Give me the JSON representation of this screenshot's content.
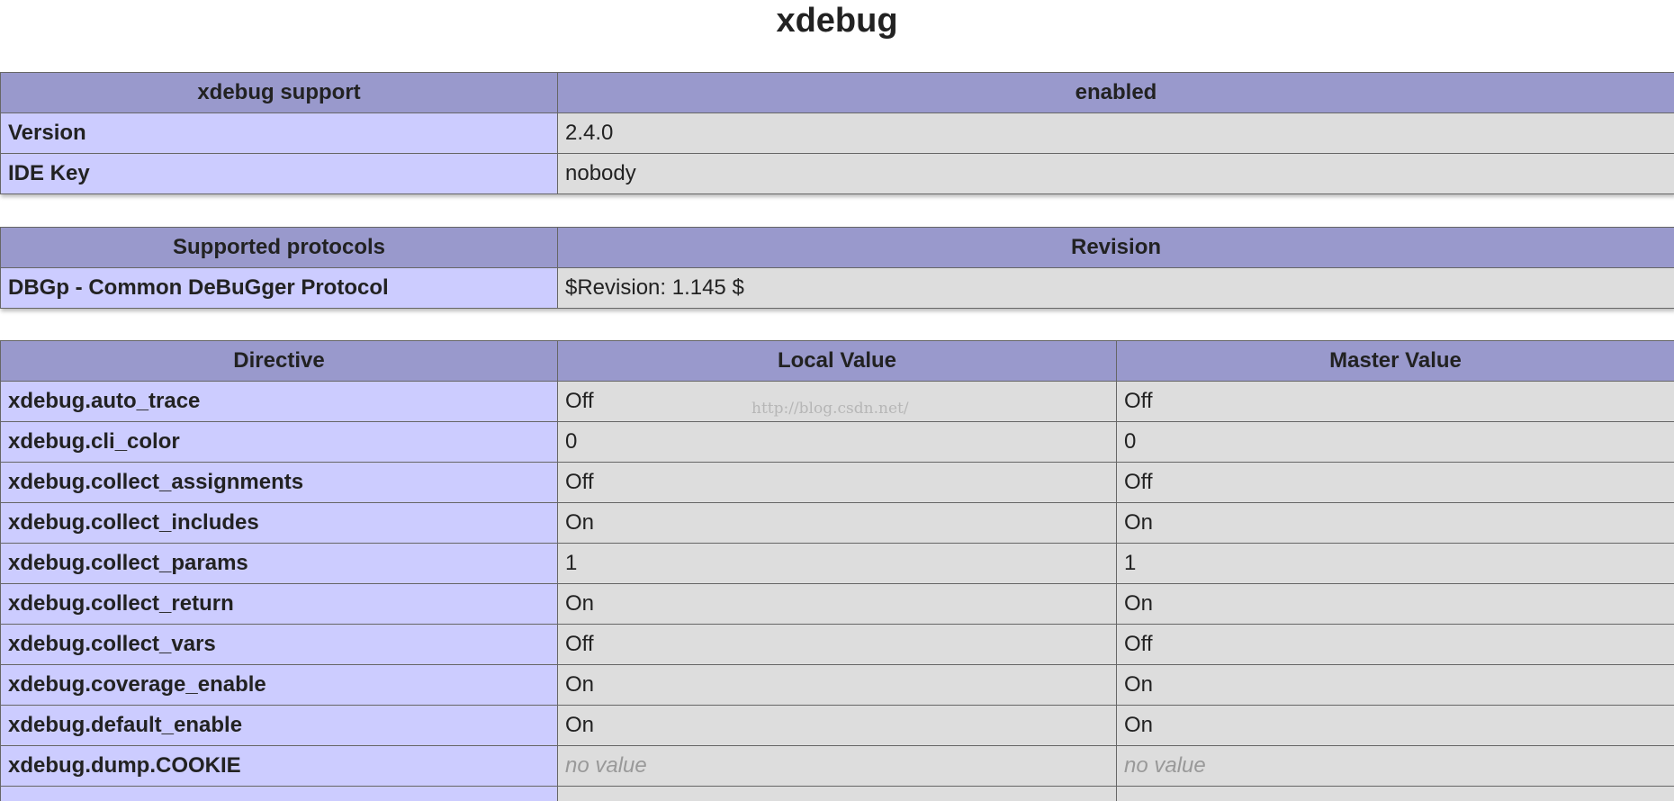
{
  "page": {
    "title": "xdebug",
    "watermark": "http://blog.csdn.net/"
  },
  "support_table": {
    "headers": [
      "xdebug support",
      "enabled"
    ],
    "rows": [
      {
        "key": "Version",
        "value": "2.4.0"
      },
      {
        "key": "IDE Key",
        "value": "nobody"
      }
    ]
  },
  "protocols_table": {
    "headers": [
      "Supported protocols",
      "Revision"
    ],
    "rows": [
      {
        "key": "DBGp - Common DeBuGger Protocol",
        "value": "$Revision: 1.145 $"
      }
    ]
  },
  "directives_table": {
    "headers": [
      "Directive",
      "Local Value",
      "Master Value"
    ],
    "rows": [
      {
        "directive": "xdebug.auto_trace",
        "local": "Off",
        "master": "Off"
      },
      {
        "directive": "xdebug.cli_color",
        "local": "0",
        "master": "0"
      },
      {
        "directive": "xdebug.collect_assignments",
        "local": "Off",
        "master": "Off"
      },
      {
        "directive": "xdebug.collect_includes",
        "local": "On",
        "master": "On"
      },
      {
        "directive": "xdebug.collect_params",
        "local": "1",
        "master": "1"
      },
      {
        "directive": "xdebug.collect_return",
        "local": "On",
        "master": "On"
      },
      {
        "directive": "xdebug.collect_vars",
        "local": "Off",
        "master": "Off"
      },
      {
        "directive": "xdebug.coverage_enable",
        "local": "On",
        "master": "On"
      },
      {
        "directive": "xdebug.default_enable",
        "local": "On",
        "master": "On"
      },
      {
        "directive": "xdebug.dump.COOKIE",
        "local": "no value",
        "master": "no value"
      },
      {
        "directive": "",
        "local": "",
        "master": ""
      }
    ]
  },
  "colors": {
    "header_bg": "#9999cc",
    "key_bg": "#ccccff",
    "value_bg": "#dddddd",
    "no_value_text": "#999999"
  }
}
